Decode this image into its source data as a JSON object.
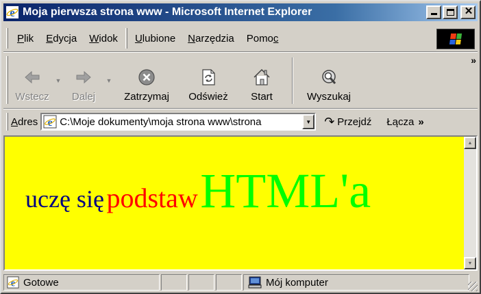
{
  "window": {
    "title": "Moja pierwsza strona www - Microsoft Internet Explorer"
  },
  "menu": {
    "items": [
      {
        "label": "Plik",
        "accel": "P",
        "rest": "lik",
        "pre": ""
      },
      {
        "label": "Edycja",
        "accel": "E",
        "rest": "dycja",
        "pre": ""
      },
      {
        "label": "Widok",
        "accel": "W",
        "rest": "idok",
        "pre": ""
      },
      {
        "label": "Ulubione",
        "accel": "U",
        "rest": "lubione",
        "pre": ""
      },
      {
        "label": "Narzędzia",
        "accel": "N",
        "rest": "arzędzia",
        "pre": ""
      },
      {
        "label": "Pomoc",
        "accel": "c",
        "rest": "",
        "pre": "Pomo"
      }
    ]
  },
  "toolbar": {
    "back": "Wstecz",
    "forward": "Dalej",
    "stop": "Zatrzymaj",
    "refresh": "Odśwież",
    "home": "Start",
    "search": "Wyszukaj",
    "more": "»"
  },
  "address": {
    "label": "Adres",
    "accel": "A",
    "rest": "dres",
    "value": "C:\\Moje dokumenty\\moja strona www\\strona",
    "go": "Przejdź",
    "links": "Łącza",
    "links_more": "»"
  },
  "page": {
    "word1": "uczę się",
    "word2": "podstaw",
    "word3": "HTML'a",
    "background": "#ffff00",
    "color1": "#000080",
    "color2": "#ff0000",
    "color3": "#00ff00"
  },
  "status": {
    "text": "Gotowe",
    "zone": "Mój komputer"
  }
}
